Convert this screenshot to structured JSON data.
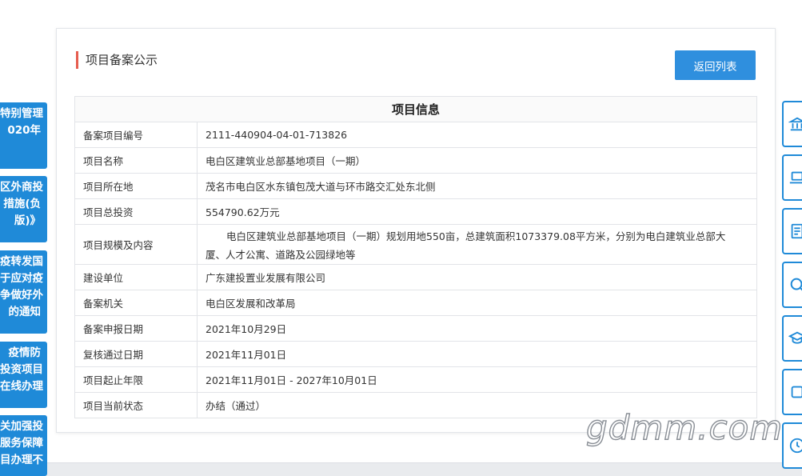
{
  "left_tabs": [
    {
      "lines": [
        "特别管理",
        "020年"
      ]
    },
    {
      "lines": [
        "区外商投",
        "措施(负",
        "版)》"
      ]
    },
    {
      "lines": [
        "疫转发国",
        "于应对疫",
        "争做好外",
        "的通知"
      ]
    },
    {
      "lines": [
        "疫情防",
        "投资项目",
        "在线办理"
      ]
    },
    {
      "lines": [
        "关加强投",
        "服务保障",
        "目办理不"
      ]
    }
  ],
  "right_tab_icons": [
    "bank-icon",
    "laptop-icon",
    "document-icon",
    "search-icon",
    "graduation-cap-icon",
    "square-icon",
    "clock-icon"
  ],
  "card": {
    "title": "项目备案公示",
    "back_label": "返回列表"
  },
  "table": {
    "heading": "项目信息",
    "rows": [
      {
        "label": "备案项目编号",
        "value": "2111-440904-04-01-713826"
      },
      {
        "label": "项目名称",
        "value": "电白区建筑业总部基地项目（一期）"
      },
      {
        "label": "项目所在地",
        "value": "茂名市电白区水东镇包茂大道与环市路交汇处东北侧"
      },
      {
        "label": "项目总投资",
        "value": "554790.62万元"
      },
      {
        "label": "项目规模及内容",
        "value": "电白区建筑业总部基地项目（一期）规划用地550亩，总建筑面积1073379.08平方米，分别为电白建筑业总部大厦、人才公寓、道路及公园绿地等"
      },
      {
        "label": "建设单位",
        "value": "广东建投置业发展有限公司"
      },
      {
        "label": "备案机关",
        "value": "电白区发展和改革局"
      },
      {
        "label": "备案申报日期",
        "value": "2021年10月29日"
      },
      {
        "label": "复核通过日期",
        "value": "2021年11月01日"
      },
      {
        "label": "项目起止年限",
        "value": "2021年11月01日 - 2027年10月01日"
      },
      {
        "label": "项目当前状态",
        "value": "办结（通过）"
      }
    ]
  },
  "watermark": "gdmm.com",
  "colors": {
    "accent": "#2f8fde",
    "title_marker": "#e65d4f",
    "tab_blue": "#1f8ad8"
  }
}
